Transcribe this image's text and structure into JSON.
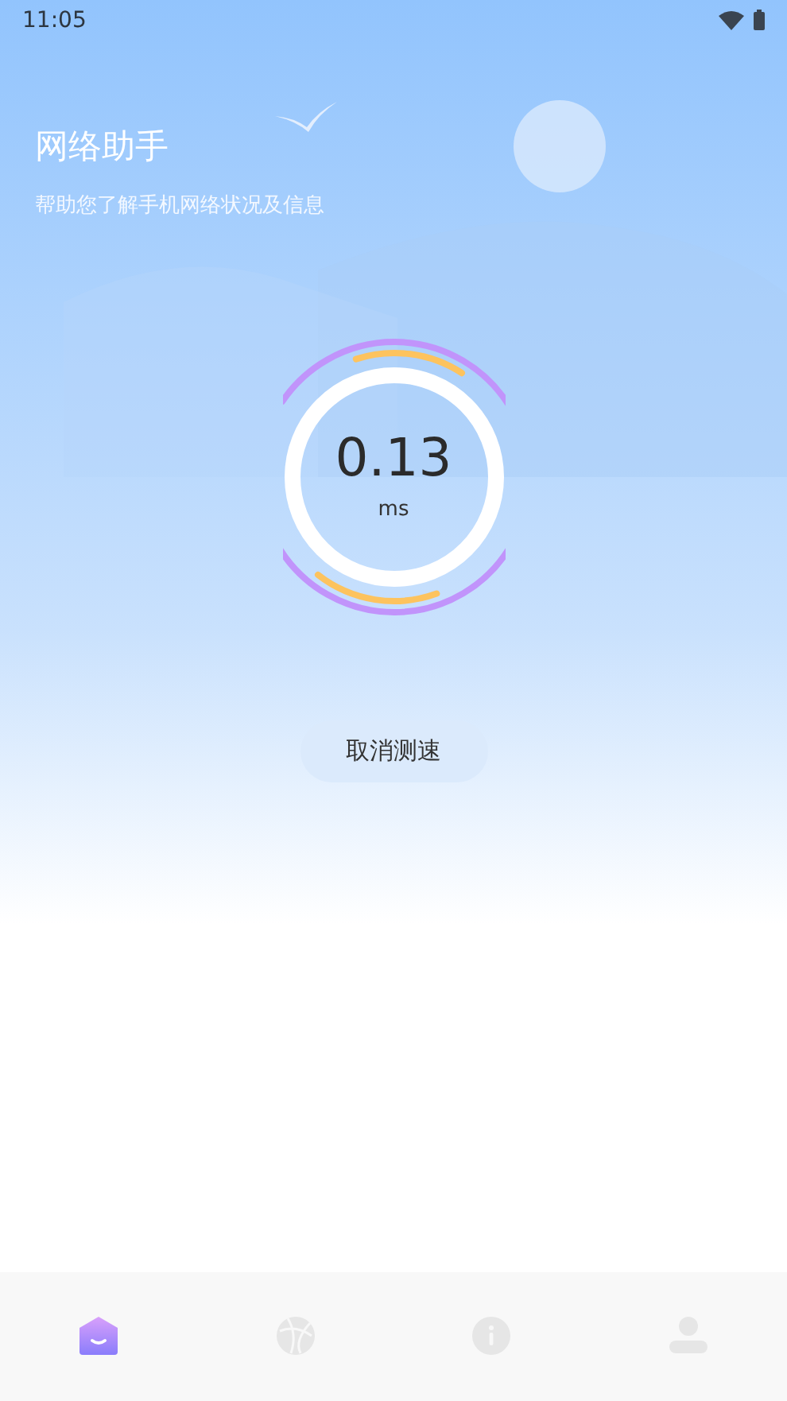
{
  "status_bar": {
    "time": "11:05"
  },
  "header": {
    "title": "网络助手",
    "subtitle": "帮助您了解手机网络状况及信息"
  },
  "speed": {
    "value": "0.13",
    "unit": "ms"
  },
  "action_button": {
    "label": "取消测速"
  },
  "tabs": [
    {
      "kind": "home",
      "selected": true
    },
    {
      "kind": "globe",
      "selected": false
    },
    {
      "kind": "info",
      "selected": false
    },
    {
      "kind": "profile",
      "selected": false
    }
  ]
}
